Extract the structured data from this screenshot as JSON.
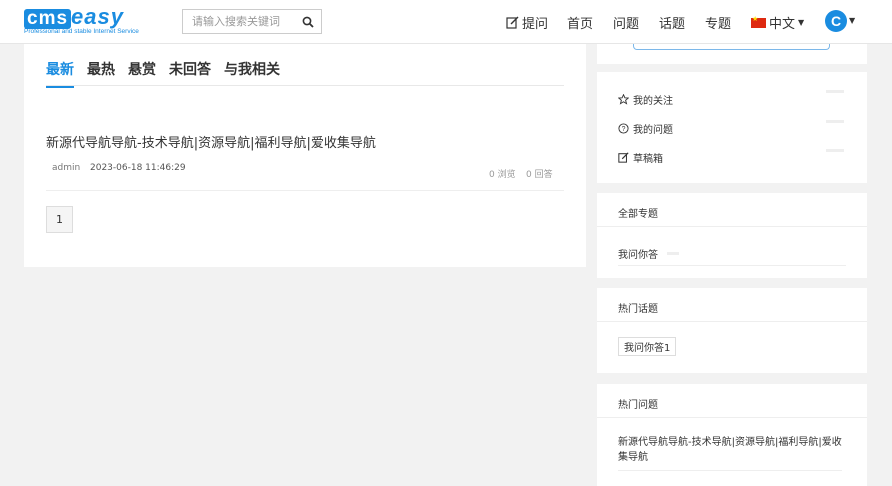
{
  "header": {
    "logo": {
      "main_cms": "cms",
      "main_easy": "easy",
      "tagline": "Professional and stable Internet Service"
    },
    "search": {
      "placeholder": "请输入搜索关键词",
      "value": ""
    },
    "nav": {
      "ask": "提问",
      "home": "首页",
      "questions": "问题",
      "topics": "话题",
      "specials": "专题",
      "language": "中文"
    },
    "avatar_letter": "C"
  },
  "colors": {
    "accent": "#1a8ce0",
    "background": "#f2f2f2"
  },
  "main": {
    "tabs": [
      {
        "label": "最新",
        "active": true
      },
      {
        "label": "最热",
        "active": false
      },
      {
        "label": "悬赏",
        "active": false
      },
      {
        "label": "未回答",
        "active": false
      },
      {
        "label": "与我相关",
        "active": false
      }
    ],
    "questions": [
      {
        "title": "新源代导航导航-技术导航|资源导航|福利导航|爱收集导航",
        "author": "admin",
        "time": "2023-06-18 11:46:29",
        "views": "0 浏览",
        "answers": "0 回答"
      }
    ],
    "pagination": {
      "current": "1"
    }
  },
  "sidebar": {
    "links": [
      {
        "label": "我的关注",
        "icon": "star-outline-icon"
      },
      {
        "label": "我的问题",
        "icon": "question-circle-icon"
      },
      {
        "label": "草稿箱",
        "icon": "edit-icon"
      }
    ],
    "all_specials": {
      "title": "全部专题",
      "items": [
        "我问你答"
      ]
    },
    "hot_topics": {
      "title": "热门话题",
      "tags": [
        "我问你答1"
      ]
    },
    "hot_questions": {
      "title": "热门问题",
      "items": [
        "新源代导航导航-技术导航|资源导航|福利导航|爱收集导航"
      ]
    }
  }
}
